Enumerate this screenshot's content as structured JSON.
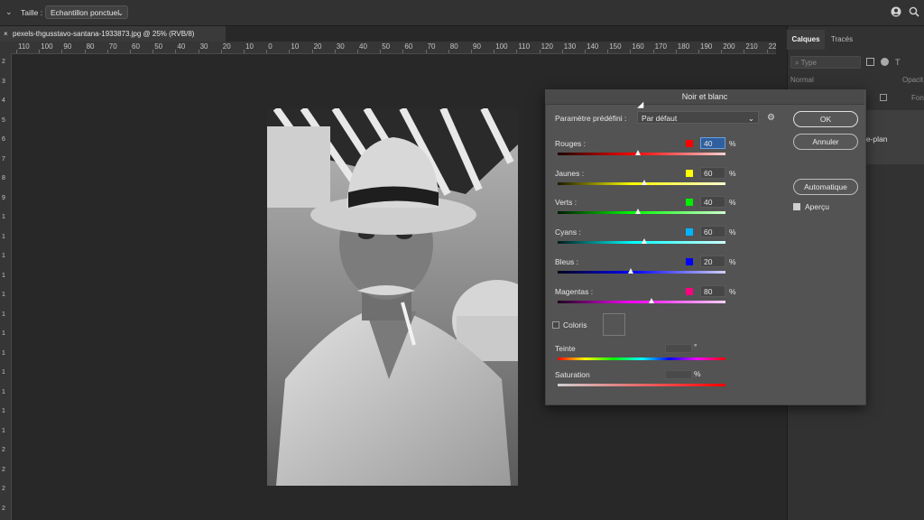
{
  "options_bar": {
    "size_label": "Taille :",
    "sample_value": "Echantillon ponctuel"
  },
  "document": {
    "tab_title": "pexels-thgusstavo-santana-1933873.jpg @ 25% (RVB/8)",
    "close_glyph": "×"
  },
  "ruler": {
    "h_labels": [
      "110",
      "100",
      "90",
      "80",
      "70",
      "60",
      "50",
      "40",
      "30",
      "20",
      "10",
      "0",
      "10",
      "20",
      "30",
      "40",
      "50",
      "60",
      "70",
      "80",
      "90",
      "100",
      "110",
      "120",
      "130",
      "140",
      "150",
      "160",
      "170",
      "180",
      "190",
      "200",
      "210",
      "22"
    ],
    "v_labels": [
      "2",
      "3",
      "4",
      "5",
      "6",
      "7",
      "8",
      "9",
      "1",
      "1",
      "1",
      "1",
      "1",
      "1",
      "1",
      "1",
      "1",
      "1",
      "1",
      "1",
      "2",
      "2",
      "2",
      "2"
    ]
  },
  "layers_panel": {
    "tab_layers": "Calques",
    "tab_paths": "Tracés",
    "filter_placeholder": "Type",
    "blend_mode": "Normal",
    "opacity_label": "Opacit",
    "fill_label": "Fon",
    "layer_name": "re-plan"
  },
  "dialog": {
    "title": "Noir et blanc",
    "preset_label": "Paramètre prédéfini :",
    "preset_value": "Par défaut",
    "ok": "OK",
    "cancel": "Annuler",
    "auto": "Automatique",
    "preview": "Aperçu",
    "percent_sign": "%",
    "degree_sign": "°",
    "sliders": [
      {
        "label": "Rouges :",
        "value": "40",
        "swatch": "#ff0000"
      },
      {
        "label": "Jaunes :",
        "value": "60",
        "swatch": "#ffff00"
      },
      {
        "label": "Verts :",
        "value": "40",
        "swatch": "#00ee00"
      },
      {
        "label": "Cyans :",
        "value": "60",
        "swatch": "#00b4ff"
      },
      {
        "label": "Bleus :",
        "value": "20",
        "swatch": "#0000ff"
      },
      {
        "label": "Magentas :",
        "value": "80",
        "swatch": "#ff0080"
      }
    ],
    "tint_checkbox": "Coloris",
    "hue_label": "Teinte",
    "saturation_label": "Saturation"
  }
}
